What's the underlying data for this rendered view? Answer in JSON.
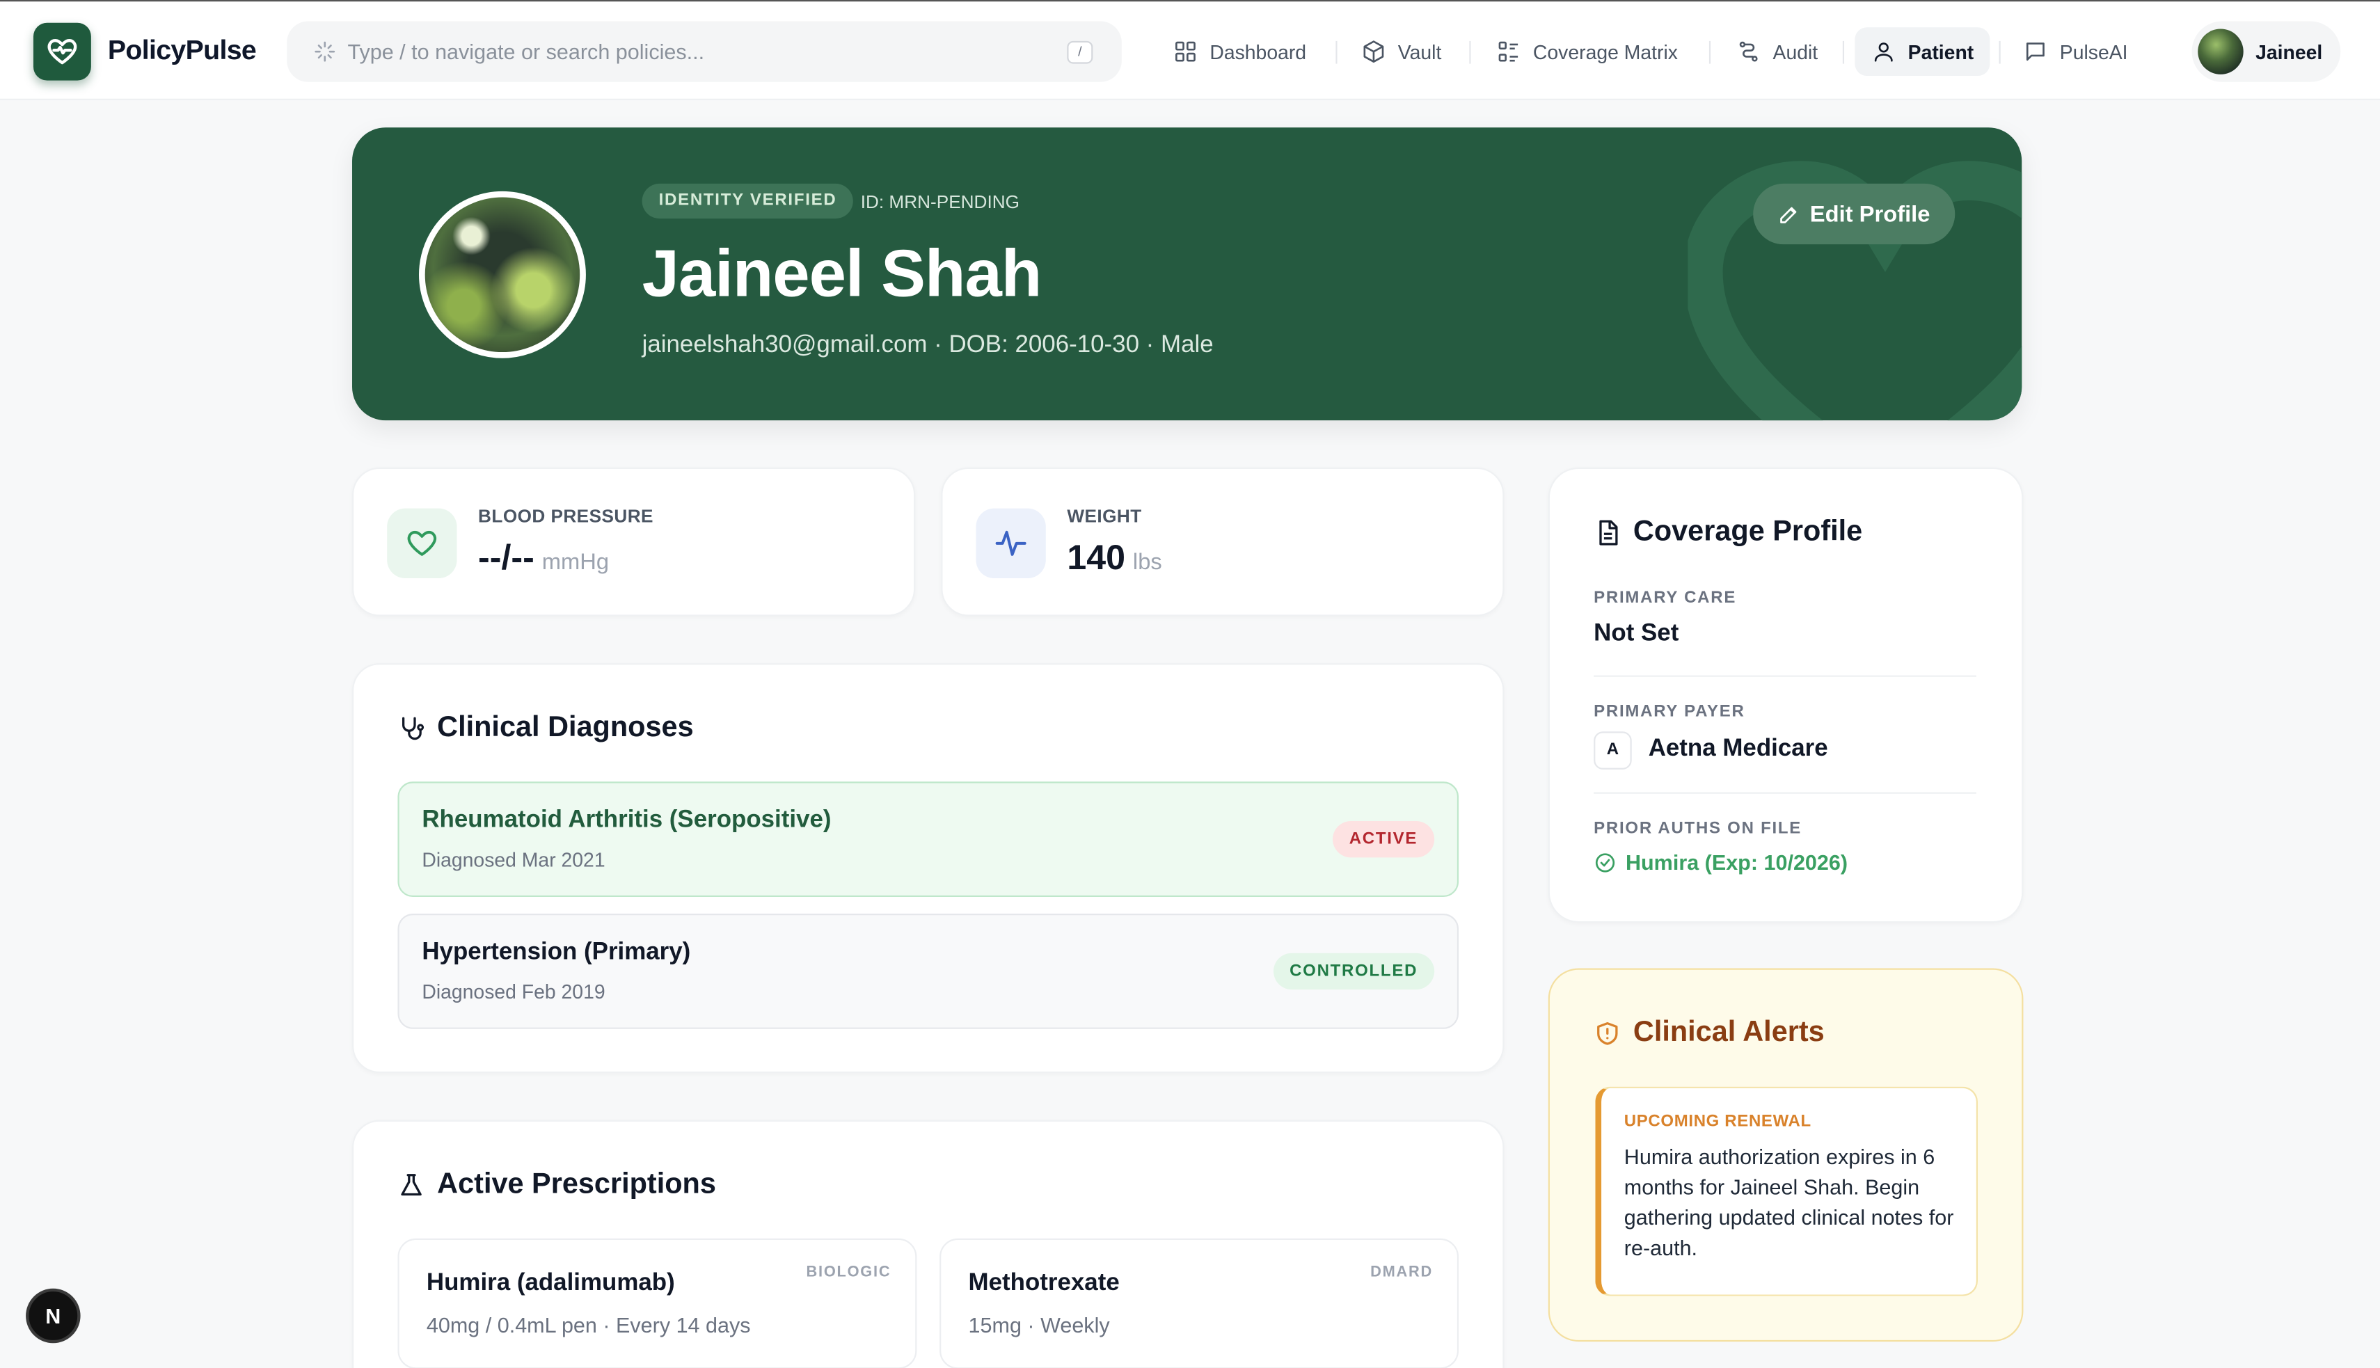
{
  "nav": {
    "brand": "PolicyPulse",
    "search_placeholder": "Type / to navigate or search policies...",
    "search_shortcut": "/",
    "items": [
      {
        "label": "Dashboard",
        "icon": "grid-icon"
      },
      {
        "label": "Vault",
        "icon": "cube-icon"
      },
      {
        "label": "Coverage Matrix",
        "icon": "list-grid-icon"
      },
      {
        "label": "Audit",
        "icon": "route-icon"
      },
      {
        "label": "Patient",
        "icon": "user-icon",
        "active": true
      },
      {
        "label": "PulseAI",
        "icon": "message-icon"
      }
    ],
    "user_name": "Jaineel"
  },
  "hero": {
    "badge": "IDENTITY VERIFIED",
    "id_text": "ID: MRN-PENDING",
    "name": "Jaineel Shah",
    "meta": "jaineelshah30@gmail.com · DOB: 2006-10-30 · Male",
    "edit_label": "Edit Profile"
  },
  "vitals": {
    "bp": {
      "label": "BLOOD PRESSURE",
      "value": "--/--",
      "unit": "mmHg"
    },
    "weight": {
      "label": "WEIGHT",
      "value": "140",
      "unit": "lbs"
    }
  },
  "diagnoses": {
    "title": "Clinical Diagnoses",
    "items": [
      {
        "name": "Rheumatoid Arthritis (Seropositive)",
        "date": "Diagnosed Mar 2021",
        "status": "ACTIVE"
      },
      {
        "name": "Hypertension (Primary)",
        "date": "Diagnosed Feb 2019",
        "status": "CONTROLLED"
      }
    ]
  },
  "prescriptions": {
    "title": "Active Prescriptions",
    "items": [
      {
        "name": "Humira (adalimumab)",
        "dose": "40mg / 0.4mL pen · Every 14 days",
        "tag": "BIOLOGIC"
      },
      {
        "name": "Methotrexate",
        "dose": "15mg · Weekly",
        "tag": "DMARD"
      }
    ]
  },
  "coverage": {
    "title": "Coverage Profile",
    "primary_care_label": "PRIMARY CARE",
    "primary_care_value": "Not Set",
    "payer_label": "PRIMARY PAYER",
    "payer_initial": "A",
    "payer_value": "Aetna Medicare",
    "auths_label": "PRIOR AUTHS ON FILE",
    "auths_value": "Humira (Exp: 10/2026)"
  },
  "alerts": {
    "title": "Clinical Alerts",
    "heading": "UPCOMING RENEWAL",
    "body": "Humira authorization expires in 6 months for Jaineel Shah. Begin gathering updated clinical notes for re-auth."
  },
  "dev_badge": "N",
  "colors": {
    "brand_green": "#255a40",
    "accent_green": "#3aa062",
    "alert_orange": "#d9822b",
    "active_red": "#b3262e"
  }
}
